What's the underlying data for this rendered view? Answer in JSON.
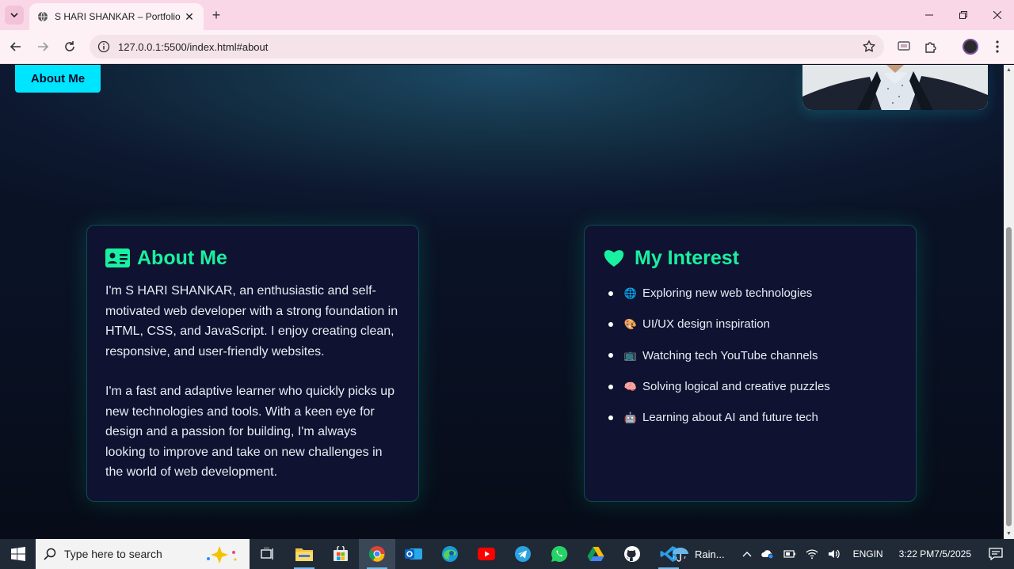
{
  "browser": {
    "tab_title": "S HARI SHANKAR – Portfolio",
    "url": "127.0.0.1:5500/index.html#about"
  },
  "page": {
    "nav_about_label": "About Me",
    "about": {
      "heading": "About Me",
      "paragraphs": [
        "I'm S HARI SHANKAR, an enthusiastic and self-motivated web developer with a strong foundation in HTML, CSS, and JavaScript. I enjoy creating clean, responsive, and user-friendly websites.",
        "I'm a fast and adaptive learner who quickly picks up new technologies and tools. With a keen eye for design and a passion for building, I'm always looking to improve and take on new challenges in the world of web development."
      ]
    },
    "interest": {
      "heading": "My Interest",
      "items": [
        {
          "emoji": "🌐",
          "text": "Exploring new web technologies"
        },
        {
          "emoji": "🎨",
          "text": "UI/UX design inspiration"
        },
        {
          "emoji": "📺",
          "text": "Watching tech YouTube channels"
        },
        {
          "emoji": "🧠",
          "text": "Solving logical and creative puzzles"
        },
        {
          "emoji": "🤖",
          "text": "Learning about AI and future tech"
        }
      ]
    }
  },
  "taskbar": {
    "search_placeholder": "Type here to search",
    "weather": "Rain...",
    "lang_line1": "ENG",
    "lang_line2": "IN",
    "time": "3:22 PM",
    "date": "7/5/2025"
  },
  "colors": {
    "accent_cyan": "#00e5ff",
    "accent_green": "#19f0a0",
    "card_bg": "#0f1230"
  }
}
